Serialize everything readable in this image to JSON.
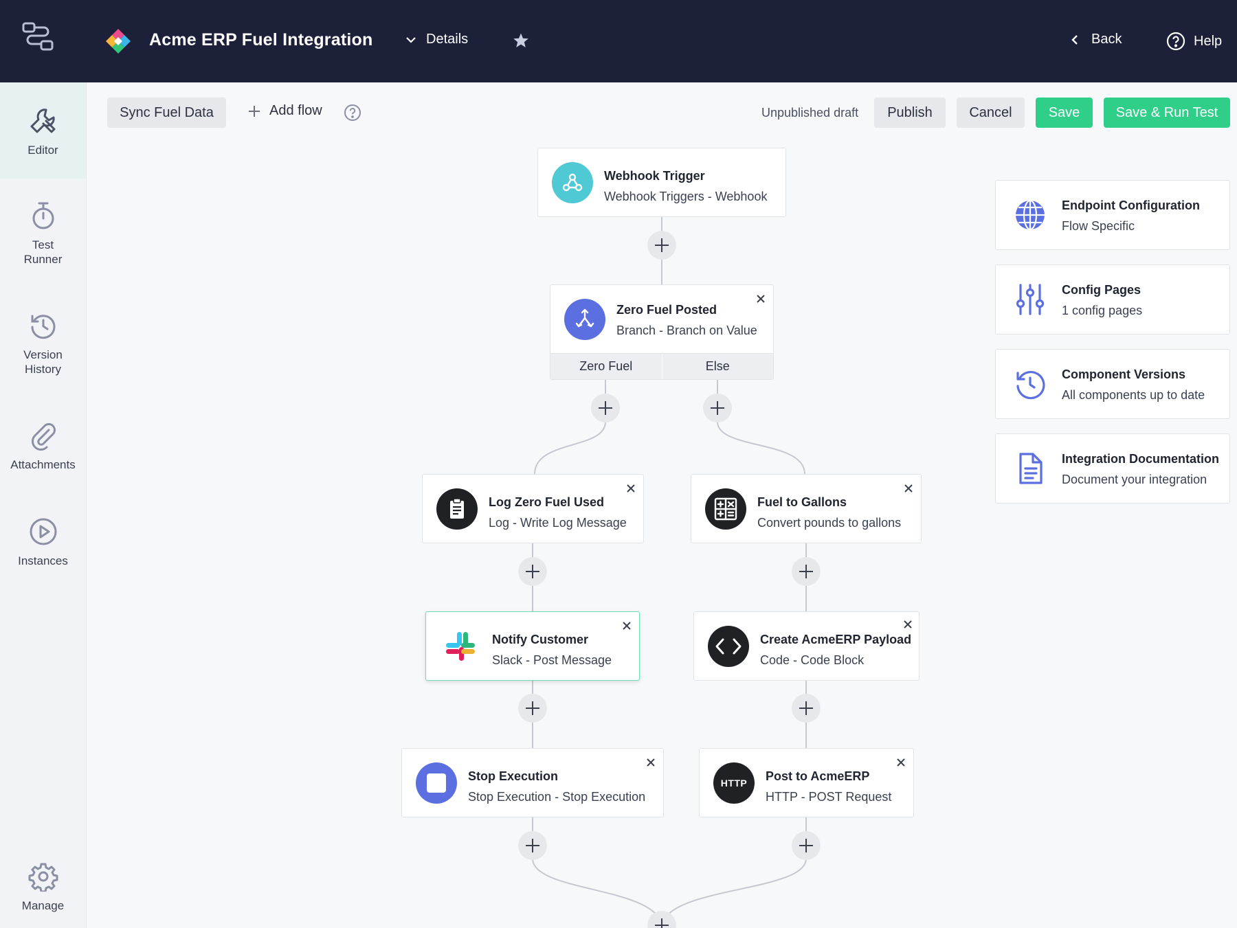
{
  "header": {
    "title": "Acme ERP Fuel Integration",
    "details_label": "Details",
    "back_label": "Back",
    "help_label": "Help"
  },
  "sidebar": {
    "items": [
      {
        "label": "Editor",
        "icon": "wrench-icon"
      },
      {
        "label": "Test\nRunner",
        "icon": "stopwatch-icon"
      },
      {
        "label": "Version\nHistory",
        "icon": "history-icon"
      },
      {
        "label": "Attachments",
        "icon": "paperclip-icon"
      },
      {
        "label": "Instances",
        "icon": "play-circle-icon"
      },
      {
        "label": "Manage",
        "icon": "gear-icon"
      }
    ]
  },
  "toolbar": {
    "flow_name": "Sync Fuel Data",
    "add_flow_label": "Add flow",
    "status": "Unpublished draft",
    "publish_label": "Publish",
    "cancel_label": "Cancel",
    "save_label": "Save",
    "save_run_label": "Save & Run Test"
  },
  "flow": {
    "trigger": {
      "title": "Webhook Trigger",
      "subtitle": "Webhook Triggers - Webhook",
      "icon": "webhook-icon"
    },
    "branch": {
      "title": "Zero Fuel Posted",
      "subtitle": "Branch - Branch on Value",
      "icon": "branch-icon",
      "tabs": [
        "Zero Fuel",
        "Else"
      ]
    },
    "left": [
      {
        "title": "Log Zero Fuel Used",
        "subtitle": "Log - Write Log Message",
        "icon": "clipboard-icon"
      },
      {
        "title": "Notify Customer",
        "subtitle": "Slack - Post Message",
        "icon": "slack-icon"
      },
      {
        "title": "Stop Execution",
        "subtitle": "Stop Execution - Stop Execution",
        "icon": "stop-icon"
      }
    ],
    "right": [
      {
        "title": "Fuel to Gallons",
        "subtitle": "Convert pounds to gallons",
        "icon": "calculator-icon"
      },
      {
        "title": "Create AcmeERP Payload",
        "subtitle": "Code - Code Block",
        "icon": "code-icon"
      },
      {
        "title": "Post to AcmeERP",
        "subtitle": "HTTP - POST Request",
        "icon": "http-icon",
        "badge": "HTTP"
      }
    ]
  },
  "panel": {
    "cards": [
      {
        "title": "Endpoint Configuration",
        "subtitle": "Flow Specific",
        "icon": "globe-icon"
      },
      {
        "title": "Config Pages",
        "subtitle": "1 config pages",
        "icon": "sliders-icon"
      },
      {
        "title": "Component Versions",
        "subtitle": "All components up to date",
        "icon": "history-icon"
      },
      {
        "title": "Integration Documentation",
        "subtitle": "Document your integration",
        "icon": "document-icon"
      }
    ]
  },
  "colors": {
    "header_bg": "#1c2038",
    "accent_green": "#2fcf8a",
    "accent_blue": "#5b6fe0",
    "webhook_teal": "#4fc9d4"
  }
}
